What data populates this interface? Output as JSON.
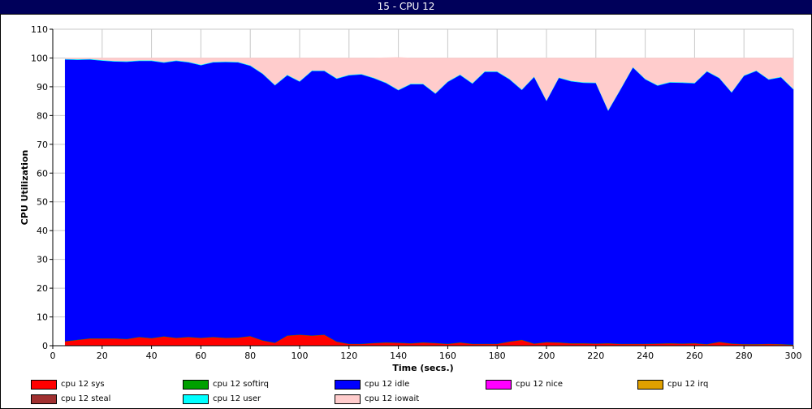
{
  "window": {
    "title": "15 - CPU 12"
  },
  "chart_data": {
    "type": "area",
    "title": "",
    "xlabel": "Time (secs.)",
    "ylabel": "CPU Utilization",
    "xlim": [
      0,
      300
    ],
    "ylim": [
      0,
      110
    ],
    "x_ticks": [
      0,
      20,
      40,
      60,
      80,
      100,
      120,
      140,
      160,
      180,
      200,
      220,
      240,
      260,
      280,
      300
    ],
    "y_ticks": [
      0,
      10,
      20,
      30,
      40,
      50,
      60,
      70,
      80,
      90,
      100,
      110
    ],
    "grid": true,
    "stacked": true,
    "legend_position": "bottom",
    "x": [
      5,
      10,
      15,
      20,
      25,
      30,
      35,
      40,
      45,
      50,
      55,
      60,
      65,
      70,
      75,
      80,
      85,
      90,
      95,
      100,
      105,
      110,
      115,
      120,
      125,
      130,
      135,
      140,
      145,
      150,
      155,
      160,
      165,
      170,
      175,
      180,
      185,
      190,
      195,
      200,
      205,
      210,
      215,
      220,
      225,
      230,
      235,
      240,
      245,
      250,
      255,
      260,
      265,
      270,
      275,
      280,
      285,
      290,
      295,
      300
    ],
    "series": [
      {
        "name": "cpu 12 sys",
        "color": "#ff0000",
        "values": [
          1.5,
          2,
          2.5,
          2.5,
          2.5,
          2.3,
          3,
          2.6,
          3.2,
          2.7,
          3,
          2.7,
          3,
          2.7,
          2.8,
          3.3,
          1.8,
          1,
          3.5,
          3.8,
          3.5,
          3.8,
          1.4,
          0.6,
          0.6,
          0.9,
          1.1,
          1,
          0.8,
          1.1,
          0.9,
          0.6,
          1.1,
          0.6,
          0.6,
          0.6,
          1.4,
          2,
          0.7,
          1.2,
          1.1,
          0.8,
          0.8,
          0.7,
          0.8,
          0.6,
          0.6,
          0.6,
          0.7,
          0.8,
          0.7,
          0.8,
          0.5,
          1.3,
          0.7,
          0.5,
          0.5,
          0.6,
          0.5,
          0.3
        ]
      },
      {
        "name": "cpu 12 softirq",
        "color": "#00a000",
        "values": [
          0.1,
          0.1,
          0.1,
          0.1,
          0.1,
          0.1,
          0.1,
          0.1,
          0.1,
          0.1,
          0.1,
          0.1,
          0.1,
          0.1,
          0.1,
          0.1,
          0.1,
          0.1,
          0.1,
          0.1,
          0.1,
          0.1,
          0.1,
          0.1,
          0.1,
          0.1,
          0.1,
          0.1,
          0.1,
          0.1,
          0.1,
          0.1,
          0.1,
          0.1,
          0.1,
          0.1,
          0.1,
          0.1,
          0.1,
          0.1,
          0.1,
          0.1,
          0.1,
          0.1,
          0.1,
          0.1,
          0.1,
          0.1,
          0.1,
          0.1,
          0.1,
          0.1,
          0.1,
          0.1,
          0.1,
          0.1,
          0.1,
          0.1,
          0.1,
          0.1
        ]
      },
      {
        "name": "cpu 12 idle",
        "color": "#0000ff",
        "values": [
          97.9,
          97.3,
          96.9,
          96.5,
          96.2,
          96.3,
          95.9,
          96.3,
          95.1,
          96.2,
          95.4,
          94.7,
          95.4,
          95.8,
          95.6,
          93.9,
          92.6,
          89.4,
          90.4,
          87.9,
          91.9,
          91.6,
          91.3,
          93.3,
          93.6,
          92,
          90.1,
          87.7,
          90,
          89.7,
          86.6,
          91,
          92.9,
          90.4,
          94.5,
          94.5,
          91.1,
          86.8,
          92.6,
          83.8,
          91.9,
          91,
          90.5,
          90.5,
          80.8,
          88.4,
          96,
          91.9,
          89.6,
          90.6,
          90.6,
          90.3,
          94.7,
          91.6,
          87.2,
          93.2,
          94.9,
          91.8,
          92.7,
          88.7
        ]
      },
      {
        "name": "cpu 12 nice",
        "color": "#ff00ff",
        "values": []
      },
      {
        "name": "cpu 12 irq",
        "color": "#e0a000",
        "values": []
      },
      {
        "name": "cpu 12 steal",
        "color": "#a03030",
        "values": []
      },
      {
        "name": "cpu 12 user",
        "color": "#00ffff",
        "values": [
          0.2,
          0.2,
          0.2,
          0.2,
          0.2,
          0.2,
          0.2,
          0.2,
          0.2,
          0.2,
          0.2,
          0.2,
          0.2,
          0.2,
          0.2,
          0.2,
          0.2,
          0.2,
          0.2,
          0.2,
          0.2,
          0.2,
          0.2,
          0.2,
          0.2,
          0.2,
          0.2,
          0.2,
          0.2,
          0.2,
          0.2,
          0.2,
          0.2,
          0.2,
          0.2,
          0.2,
          0.2,
          0.2,
          0.2,
          0.2,
          0.2,
          0.2,
          0.2,
          0.2,
          0.2,
          0.2,
          0.2,
          0.2,
          0.2,
          0.2,
          0.2,
          0.2,
          0.2,
          0.2,
          0.2,
          0.2,
          0.2,
          0.2,
          0.2,
          0.2
        ]
      },
      {
        "name": "cpu 12 iowait",
        "color": "#ffcccc",
        "values": [
          0.3,
          0.4,
          0.3,
          0.7,
          1,
          1.1,
          0.8,
          0.8,
          1.4,
          0.8,
          1.3,
          2.3,
          1.3,
          1.2,
          1.3,
          2.5,
          5.3,
          9.3,
          5.8,
          8,
          4.3,
          4.3,
          7,
          5.8,
          5.5,
          6.8,
          8.6,
          11.2,
          8.9,
          8.9,
          12.2,
          8.1,
          5.7,
          8.7,
          4.6,
          4.6,
          7.2,
          10.9,
          6.4,
          14.7,
          6.7,
          7.9,
          8.4,
          8.5,
          18.1,
          10.7,
          3.1,
          7.2,
          9.4,
          8.3,
          8.4,
          8.6,
          4.5,
          6.8,
          11.8,
          6,
          4.3,
          7.3,
          6.5,
          10.7
        ]
      }
    ]
  }
}
